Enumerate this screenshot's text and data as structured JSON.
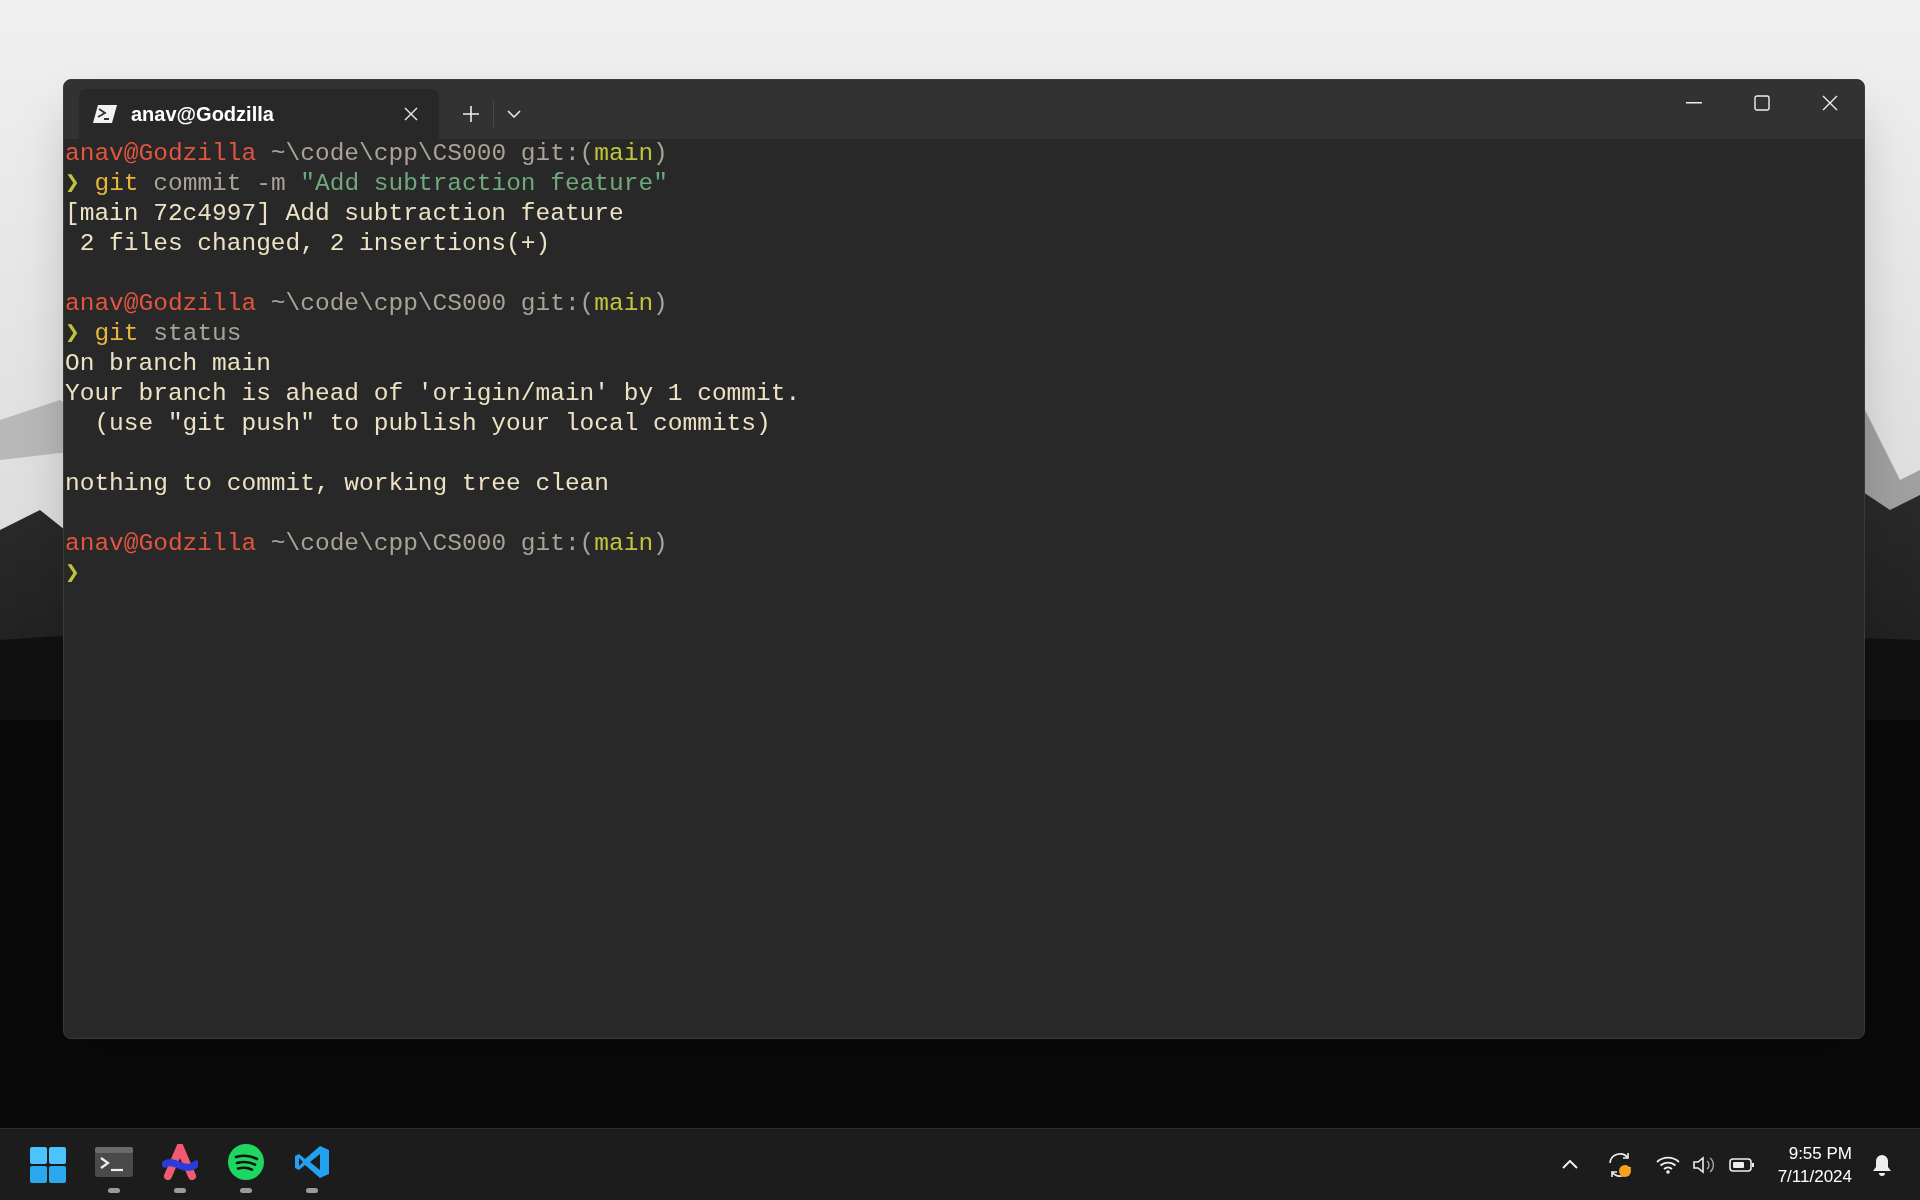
{
  "window": {
    "tabs": [
      {
        "title": "anav@Godzilla",
        "selected": true
      }
    ]
  },
  "terminal": {
    "lines": [
      {
        "kind": "text",
        "segments": [
          {
            "kind": "user",
            "text": "anav@Godzilla"
          },
          {
            "kind": "path",
            "text": " ~\\code\\cpp\\CS000 git:("
          },
          {
            "kind": "branch",
            "text": "main"
          },
          {
            "kind": "path",
            "text": ")"
          }
        ]
      },
      {
        "kind": "text",
        "segments": [
          {
            "kind": "prompt",
            "text": "❯"
          },
          {
            "kind": "command",
            "text": " git"
          },
          {
            "kind": "arg",
            "text": " commit -m"
          },
          {
            "kind": "string",
            "text": " \"Add subtraction feature\""
          }
        ]
      },
      {
        "kind": "text",
        "segments": [
          {
            "kind": "output",
            "text": "[main 72c4997] Add subtraction feature"
          }
        ]
      },
      {
        "kind": "text",
        "segments": [
          {
            "kind": "output",
            "text": " 2 files changed, 2 insertions(+)"
          }
        ]
      },
      {
        "kind": "blank"
      },
      {
        "kind": "text",
        "segments": [
          {
            "kind": "user",
            "text": "anav@Godzilla"
          },
          {
            "kind": "path",
            "text": " ~\\code\\cpp\\CS000 git:("
          },
          {
            "kind": "branch",
            "text": "main"
          },
          {
            "kind": "path",
            "text": ")"
          }
        ]
      },
      {
        "kind": "text",
        "segments": [
          {
            "kind": "prompt",
            "text": "❯"
          },
          {
            "kind": "command",
            "text": " git"
          },
          {
            "kind": "arg",
            "text": " status"
          }
        ]
      },
      {
        "kind": "text",
        "segments": [
          {
            "kind": "output",
            "text": "On branch main"
          }
        ]
      },
      {
        "kind": "text",
        "segments": [
          {
            "kind": "output",
            "text": "Your branch is ahead of 'origin/main' by 1 commit."
          }
        ]
      },
      {
        "kind": "text",
        "segments": [
          {
            "kind": "output",
            "text": "  (use \"git push\" to publish your local commits)"
          }
        ]
      },
      {
        "kind": "blank"
      },
      {
        "kind": "text",
        "segments": [
          {
            "kind": "output",
            "text": "nothing to commit, working tree clean"
          }
        ]
      },
      {
        "kind": "blank"
      },
      {
        "kind": "text",
        "segments": [
          {
            "kind": "user",
            "text": "anav@Godzilla"
          },
          {
            "kind": "path",
            "text": " ~\\code\\cpp\\CS000 git:("
          },
          {
            "kind": "branch",
            "text": "main"
          },
          {
            "kind": "path",
            "text": ")"
          }
        ]
      },
      {
        "kind": "text",
        "segments": [
          {
            "kind": "prompt",
            "text": "❯"
          }
        ]
      }
    ]
  },
  "taskbar": {
    "apps": [
      {
        "kind": "terminal",
        "running": true
      },
      {
        "kind": "arc",
        "running": true
      },
      {
        "kind": "spotify",
        "running": true
      },
      {
        "kind": "vscode",
        "running": true
      }
    ],
    "tray": {
      "time": "9:55 PM",
      "date": "7/11/2024",
      "update_pending": true
    }
  }
}
